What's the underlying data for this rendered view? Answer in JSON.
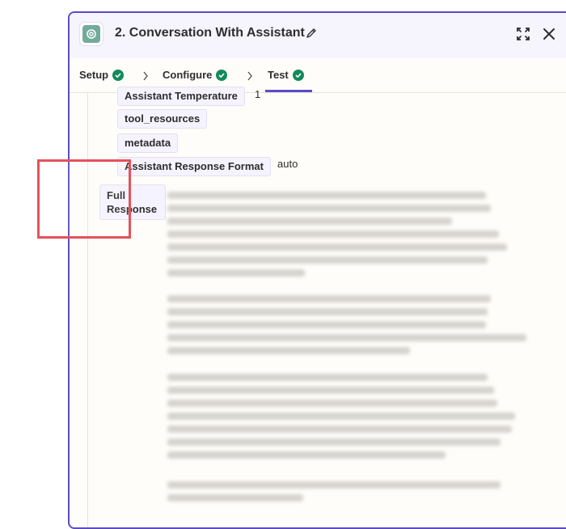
{
  "header": {
    "title": "2. Conversation With Assistant",
    "icons": [
      "openai-logo-icon",
      "pencil-icon",
      "expand-icon",
      "close-icon"
    ]
  },
  "tabs": [
    {
      "label": "Setup",
      "status": "complete"
    },
    {
      "label": "Configure",
      "status": "complete"
    },
    {
      "label": "Test",
      "status": "complete",
      "active": true
    }
  ],
  "fields": [
    {
      "label": "Assistant Temperature",
      "value": "1"
    },
    {
      "label": "tool_resources",
      "value": ""
    },
    {
      "label": "metadata",
      "value": ""
    },
    {
      "label": "Assistant Response Format",
      "value": "auto"
    }
  ],
  "full_response": {
    "label": "Full Response"
  },
  "colors": {
    "accent": "#5b4cc4",
    "success": "#138a5b",
    "highlight": "#e4525b",
    "chip_bg": "#f5f3ff"
  }
}
